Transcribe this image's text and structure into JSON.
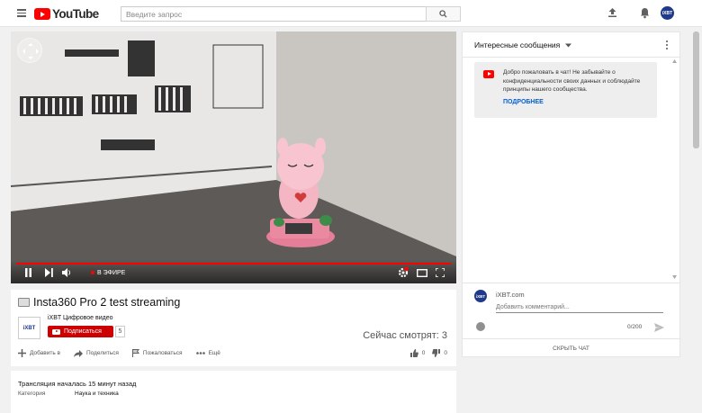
{
  "header": {
    "logo_text": "YouTube",
    "search_placeholder": "Введите запрос"
  },
  "user": {
    "avatar_text": "iXBT"
  },
  "video": {
    "live_label": "В ЭФИРЕ",
    "progress": 1.0
  },
  "info": {
    "title": "Insta360 Pro 2 test streaming",
    "channel_name": "iXBT Цифровое видео",
    "channel_logo_text": "iXBT",
    "subscribe_label": "Подписаться",
    "subscriber_count": "5",
    "viewers_text": "Сейчас смотрят: 3",
    "actions": [
      "Добавить в",
      "Поделиться",
      "Пожаловаться",
      "Ещё"
    ],
    "likes": "0",
    "dislikes": "0"
  },
  "description": {
    "line": "Трансляция началась 15 минут назад",
    "category_label": "Категория",
    "category_value": "Наука и техника"
  },
  "chat": {
    "header_title": "Интересные сообщения",
    "welcome_text": "Добро пожаловать в чат! Не забывайте о конфиденциальности своих данных и соблюдайте принципы нашего сообщества.",
    "more_label": "ПОДРОБНЕЕ",
    "user_name": "iXBT.com",
    "input_placeholder": "Добавить комментарий...",
    "char_count": "0/200",
    "hide_label": "СКРЫТЬ ЧАТ"
  },
  "colors": {
    "brand_red": "#ff0000",
    "subscribe_red": "#cc0000",
    "link_blue": "#065fd4"
  }
}
